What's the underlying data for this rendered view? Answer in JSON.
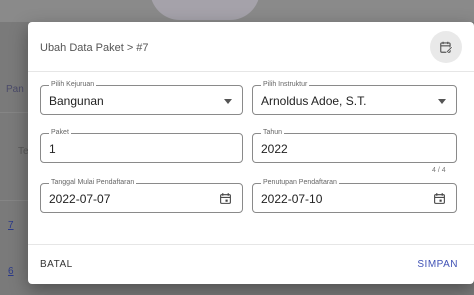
{
  "background": {
    "left_labels": [
      "Pan",
      "Te"
    ],
    "links": [
      "7",
      "6"
    ],
    "right_fragments": [
      "e",
      "0",
      "0"
    ]
  },
  "dialog": {
    "title": "Ubah Data Paket > #7",
    "header_icon": "edit-calendar-icon",
    "fields": {
      "kejuruan": {
        "label": "Pilih Kejuruan",
        "value": "Bangunan"
      },
      "instruktur": {
        "label": "Pilih Instruktur",
        "value": "Arnoldus Adoe, S.T."
      },
      "paket": {
        "label": "Paket",
        "value": "1"
      },
      "tahun": {
        "label": "Tahun",
        "value": "2022",
        "counter": "4 / 4"
      },
      "tanggal_mulai": {
        "label": "Tanggal Mulai Pendaftaran",
        "value": "2022-07-07"
      },
      "penutupan": {
        "label": "Penutupan Pendaftaran",
        "value": "2022-07-10"
      }
    },
    "footer": {
      "cancel": "BATAL",
      "save": "SIMPAN"
    }
  },
  "colors": {
    "accent": "#3f51b5",
    "border": "#8a8a8a"
  }
}
